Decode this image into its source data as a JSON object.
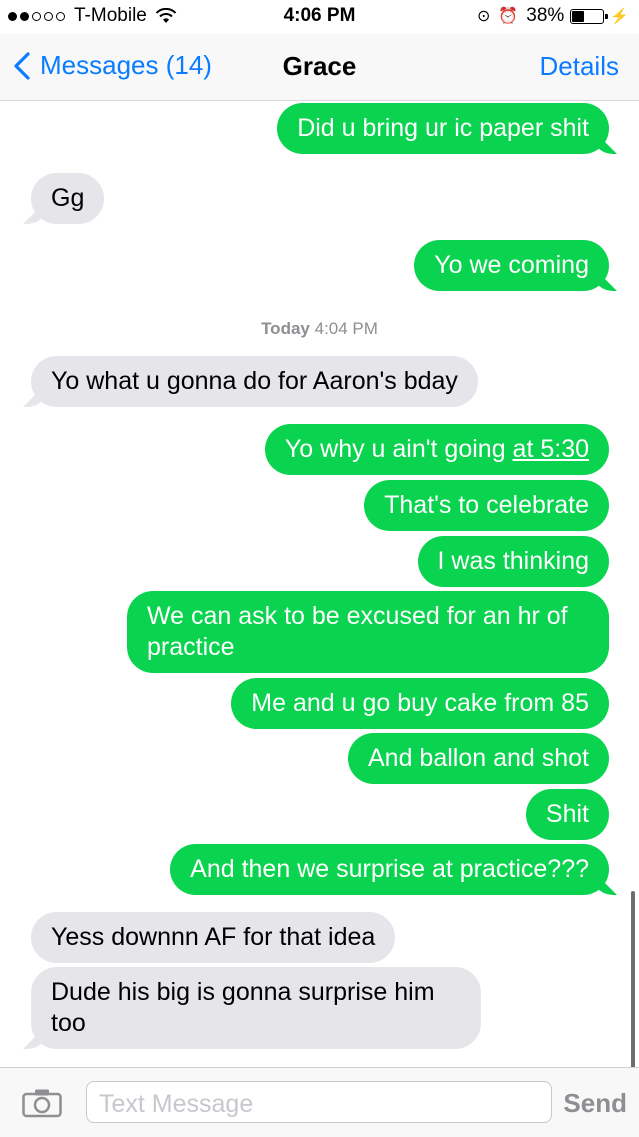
{
  "status_bar": {
    "carrier": "T-Mobile",
    "time": "4:06 PM",
    "battery": "38%",
    "icons": [
      "signal-dots-icon",
      "wifi-icon",
      "rotation-lock-icon",
      "alarm-icon",
      "battery-icon",
      "charging-bolt-icon"
    ]
  },
  "nav": {
    "back_label": "Messages (14)",
    "title": "Grace",
    "details_label": "Details"
  },
  "timestamp": {
    "day": "Today",
    "time": "4:04 PM"
  },
  "messages": [
    {
      "from": "me",
      "text": "Did u bring ur ic paper shit"
    },
    {
      "from": "them",
      "text": "Gg"
    },
    {
      "from": "me",
      "text": "Yo we coming"
    },
    {
      "from": "them",
      "text": "Yo what u gonna do for Aaron's bday"
    },
    {
      "from": "me",
      "text_before": "Yo why u ain't going ",
      "text_link": "at 5:30"
    },
    {
      "from": "me",
      "text": "That's to celebrate"
    },
    {
      "from": "me",
      "text": "I was thinking"
    },
    {
      "from": "me",
      "text": "We can ask to be excused for an hr of practice"
    },
    {
      "from": "me",
      "text": "Me and u go buy cake from 85"
    },
    {
      "from": "me",
      "text": "And ballon and shot"
    },
    {
      "from": "me",
      "text": "Shit"
    },
    {
      "from": "me",
      "text": "And then we surprise at practice???"
    },
    {
      "from": "them",
      "text": "Yess downnn AF for that idea"
    },
    {
      "from": "them",
      "text": "Dude his big is gonna surprise him too"
    }
  ],
  "input_bar": {
    "placeholder": "Text Message",
    "send_label": "Send"
  },
  "colors": {
    "sent_bubble": "#0ad34f",
    "received_bubble": "#e5e5ea",
    "accent": "#0b7cff"
  }
}
